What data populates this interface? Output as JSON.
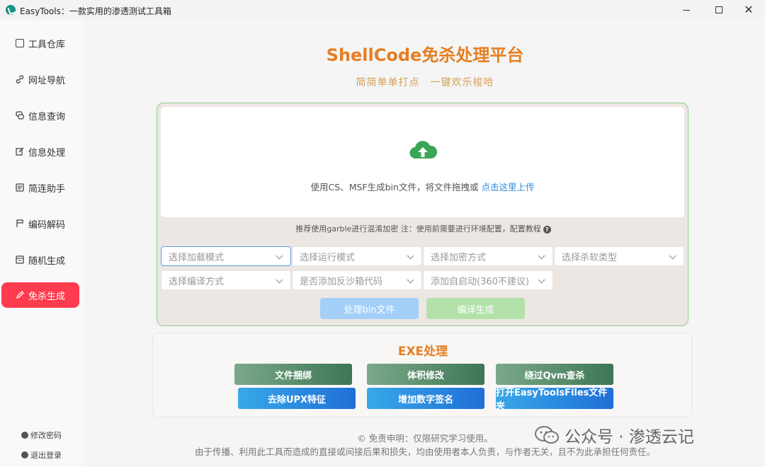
{
  "window": {
    "title": "EasyTools：一款实用的渗透测试工具箱",
    "close_glyph": "✕"
  },
  "sidebar": {
    "items": [
      {
        "label": "工具仓库",
        "icon": "box-icon"
      },
      {
        "label": "网址导航",
        "icon": "link-icon"
      },
      {
        "label": "信息查询",
        "icon": "chat-icon"
      },
      {
        "label": "信息处理",
        "icon": "edit-icon"
      },
      {
        "label": "简连助手",
        "icon": "list-icon"
      },
      {
        "label": "编码解码",
        "icon": "flag-icon"
      },
      {
        "label": "随机生成",
        "icon": "dice-icon"
      },
      {
        "label": "免杀生成",
        "icon": "pencil-icon",
        "active": true
      }
    ],
    "change_password": "修改密码",
    "logout": "退出登录"
  },
  "main": {
    "title": "ShellCode免杀处理平台",
    "subtitle": "简简单单打点　一键欢乐梭哈",
    "upload": {
      "text": "使用CS、MSF生成bin文件，将文件拖拽或 ",
      "link": "点击这里上传",
      "hint": "推荐使用garble进行混淆加密 注：使用前需要进行环境配置，配置教程",
      "hint_icon": "?"
    },
    "selects": {
      "load_mode": "选择加载模式",
      "run_mode": "选择运行模式",
      "encrypt_mode": "选择加密方式",
      "av_type": "选择杀软类型",
      "compile_mode": "选择编译方式",
      "sandbox": "是否添加反沙箱代码",
      "autostart": "添加自启动(360不建议)"
    },
    "buttons": {
      "process_bin": "处理bin文件",
      "compile": "编译生成"
    },
    "exe": {
      "title": "EXE处理",
      "bind": "文件捆绑",
      "size": "体积修改",
      "qvm": "绕过Qvm查杀",
      "upx": "去除UPX特征",
      "sign": "增加数字签名",
      "open_folder": "打开EasyToolsFiles文件夹"
    },
    "footer": {
      "line1": "© 免责申明：仅限研究学习使用。",
      "line2": "由于传播、利用此工具而造成的直接或间接后果和损失，均由使用者本人负责，与作者无关，且不为此承担任何责任。"
    },
    "watermark": "公众号 · 渗透云记"
  },
  "colors": {
    "accent_orange": "#e67e22",
    "active_red": "#ff3b4f",
    "link_blue": "#2f8bd8",
    "cloud_green": "#3aa655"
  }
}
